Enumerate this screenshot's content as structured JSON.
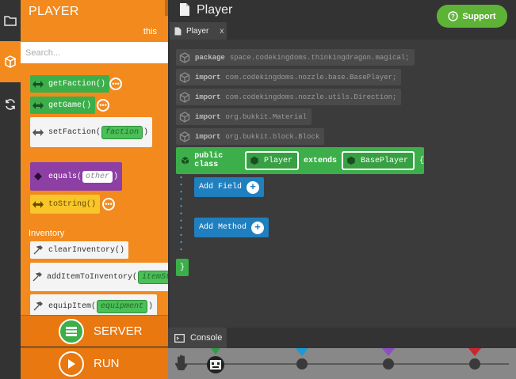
{
  "panel": {
    "title": "PLAYER",
    "context": "this",
    "search_placeholder": "Search...",
    "blocks": [
      {
        "label": "getFaction()"
      },
      {
        "label": "getGame()"
      },
      {
        "label": "setFaction(",
        "param": "faction",
        "close": ")"
      },
      {
        "label": "equals(",
        "param": "other",
        "close": ")"
      },
      {
        "label": "toString()"
      }
    ],
    "inventory_section": "Inventory",
    "inventory_blocks": [
      {
        "label": "clearInventory()"
      },
      {
        "label": "addItemToInventory(",
        "param": "itemSt"
      },
      {
        "label": "equipItem(",
        "param": "equipment",
        "close": ")"
      }
    ],
    "more_glyph": "•••"
  },
  "actions": {
    "server": "SERVER",
    "run": "RUN"
  },
  "editor": {
    "file_title": "Player",
    "tab_label": "Player",
    "tab_close": "x",
    "support_label": "Support",
    "imports": [
      {
        "kw": "package",
        "value": "space.codekingdoms.thinkingdragon.magical;"
      },
      {
        "kw": "import",
        "value": "com.codekingdoms.nozzle.base.BasePlayer;"
      },
      {
        "kw": "import",
        "value": "com.codekingdoms.nozzle.utils.Direction;"
      },
      {
        "kw": "import",
        "value": "org.bukkit.Material"
      },
      {
        "kw": "import",
        "value": "org.bukkit.block.Block"
      }
    ],
    "class_decl": {
      "kw_public_class": "public class",
      "name": "Player",
      "kw_extends": "extends",
      "parent": "BasePlayer",
      "open_brace": "{",
      "close_brace": "}"
    },
    "add_field": "Add Field",
    "add_method": "Add Method"
  },
  "console": {
    "label": "Console"
  },
  "colors": {
    "panel_orange": "#f28a1e",
    "block_green": "#3caf4a",
    "add_blue": "#1f7fbf",
    "support_green": "#5db336",
    "marker_blue": "#1a9bd1",
    "marker_purple": "#8c4fc0",
    "marker_red": "#c7282e"
  }
}
